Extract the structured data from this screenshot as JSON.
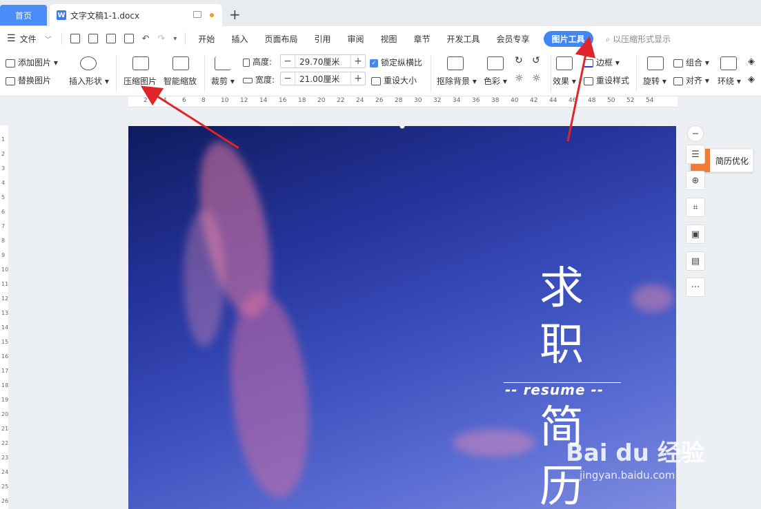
{
  "tabs": {
    "home": "首页",
    "document": "文字文稿1-1.docx",
    "new_tab": "+"
  },
  "menu": {
    "file": "文件",
    "items": [
      "开始",
      "插入",
      "页面布局",
      "引用",
      "审阅",
      "视图",
      "章节",
      "开发工具",
      "会员专享"
    ],
    "picture_tools": "图片工具",
    "search_hint": "以压缩形式显示"
  },
  "ribbon": {
    "add_picture": "添加图片",
    "replace_picture": "替换图片",
    "insert_shape": "插入形状",
    "compress_picture": "压缩图片",
    "smart_scale": "智能缩放",
    "crop": "裁剪",
    "height_label": "高度:",
    "height_value": "29.70厘米",
    "width_label": "宽度:",
    "width_value": "21.00厘米",
    "lock_ratio": "锁定纵横比",
    "reset_size": "重设大小",
    "remove_bg": "抠除背景",
    "color": "色彩",
    "effects": "效果",
    "border": "边框",
    "reset_style": "重设样式",
    "rotate": "旋转",
    "group": "组合",
    "align": "对齐",
    "wrap": "环绕"
  },
  "ruler": {
    "marks": [
      "2",
      "4",
      "6",
      "8",
      "10",
      "12",
      "14",
      "16",
      "18",
      "20",
      "22",
      "24",
      "26",
      "28",
      "30",
      "32",
      "34",
      "36",
      "38",
      "40",
      "42",
      "44",
      "46",
      "48",
      "50",
      "52",
      "54"
    ],
    "vmarks": [
      "1",
      "2",
      "3",
      "4",
      "5",
      "6",
      "7",
      "8",
      "9",
      "10",
      "11",
      "12",
      "13",
      "14",
      "15",
      "16",
      "17",
      "18",
      "19",
      "20",
      "21",
      "22",
      "23",
      "24",
      "25",
      "26"
    ]
  },
  "document_image": {
    "char1": "求",
    "char2": "职",
    "resume": "-- resume --",
    "char3": "简",
    "char4": "历"
  },
  "float_toolbar": {
    "more": "···",
    "tip": "简历优化"
  },
  "watermark": {
    "logo": "Bai du 经验",
    "url": "jingyan.baidu.com"
  },
  "colors": {
    "accent": "#3e87f5",
    "arrow": "#e0242a",
    "tip_badge": "#f07a3a"
  }
}
